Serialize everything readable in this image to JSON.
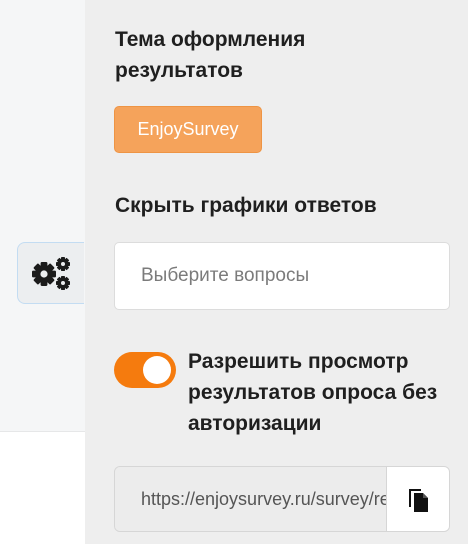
{
  "settings_tab": {
    "icon": "gears-icon"
  },
  "results_theme": {
    "title": "Тема оформления результатов",
    "selected_theme": "EnjoySurvey",
    "accent_color": "#f5a35b"
  },
  "hide_answer_charts": {
    "title": "Скрыть графики ответов",
    "placeholder": "Выберите вопросы"
  },
  "public_results": {
    "toggle_on": true,
    "toggle_color": "#f57b0e",
    "label": "Разрешить просмотр результатов опроса без авторизации",
    "link_value": "https://enjoysurvey.ru/survey/results",
    "copy_icon": "copy-icon"
  }
}
